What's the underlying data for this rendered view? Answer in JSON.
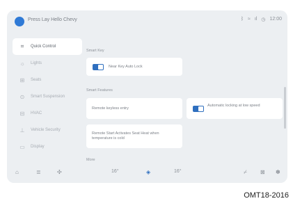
{
  "statusbar": {
    "profile_name": "Press Lay Hello Chevy",
    "icons": [
      "bluetooth-icon",
      "wifi-icon",
      "signal-icon",
      "clock-icon"
    ],
    "time": "12:00"
  },
  "sidebar": {
    "items": [
      {
        "label": "Quick Control",
        "icon": "grid-icon",
        "active": true
      },
      {
        "label": "Lights",
        "icon": "sun-icon"
      },
      {
        "label": "Seats",
        "icon": "seat-icon"
      },
      {
        "label": "Smart Suspension",
        "icon": "suspension-icon"
      },
      {
        "label": "HVAC",
        "icon": "climate-icon"
      },
      {
        "label": "Vehicle Security",
        "icon": "lock-icon"
      },
      {
        "label": "Display",
        "icon": "display-icon"
      }
    ]
  },
  "main": {
    "section1_title": "Smart Key",
    "card1_text": "Near Key Auto Lock",
    "section2_title": "Smart Features",
    "card2_text": "Remote keyless entry",
    "card3_text": "Automatic locking at low speed",
    "card4_text": "Remote Start Activates Seat Heat when temperature is cold",
    "section3_title": "More"
  },
  "bottombar": {
    "left_temp": "16°",
    "right_temp": "16°",
    "icons": [
      "home-icon",
      "seat-heat-icon",
      "fan-icon",
      "climate-center-icon",
      "defrost-icon",
      "rear-defrost-icon",
      "settings-icon"
    ]
  },
  "caption": "OMT18-2016",
  "colors": {
    "accent": "#2f6fbf",
    "screen_bg": "#eceff2"
  }
}
